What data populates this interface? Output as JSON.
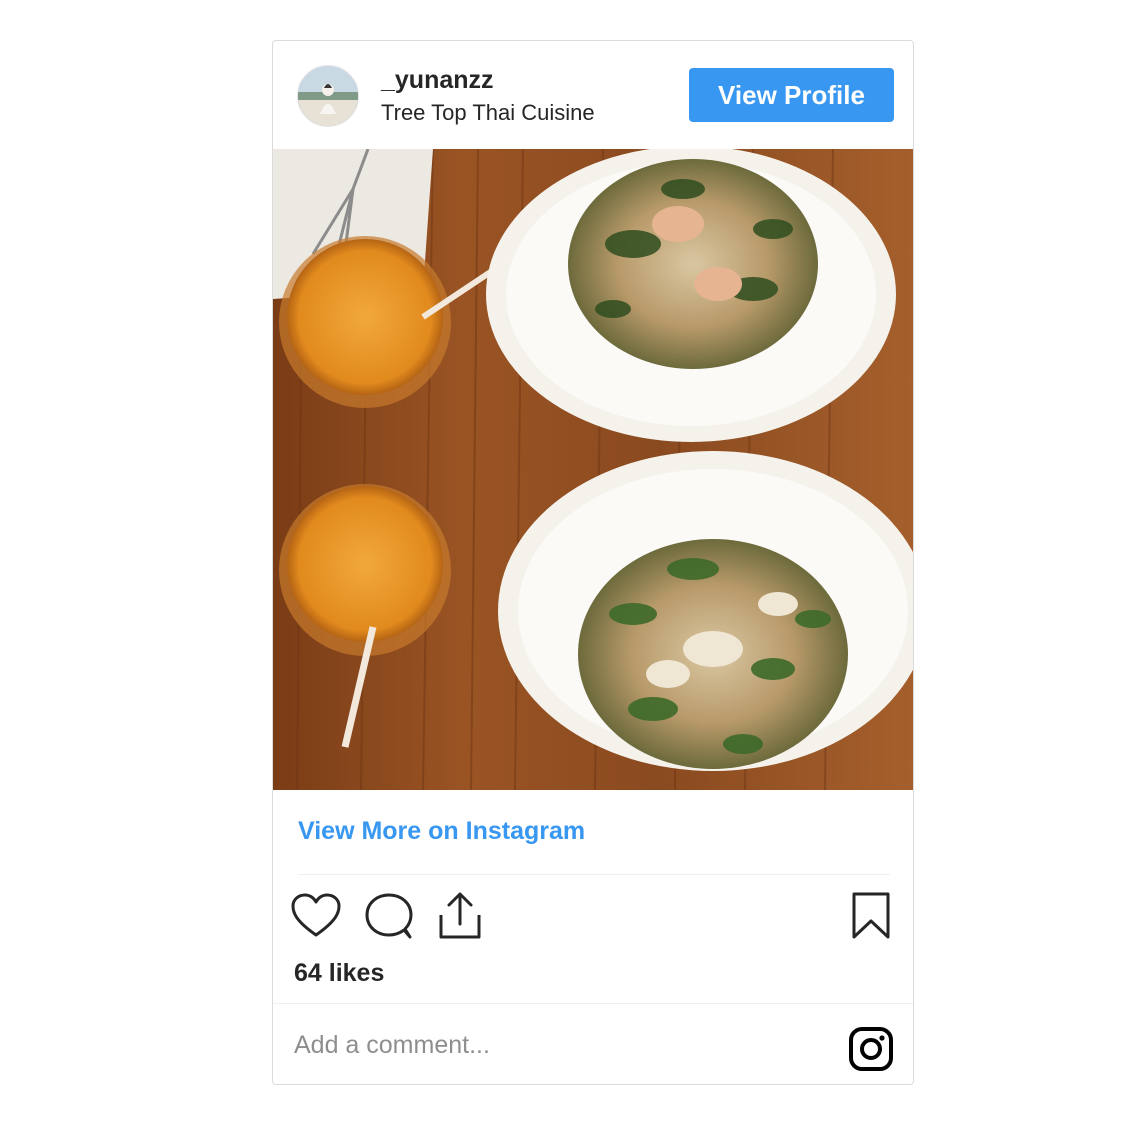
{
  "post": {
    "username": "_yunanzz",
    "location": "Tree Top Thai Cuisine",
    "view_profile_label": "View Profile",
    "view_more_label": "View More on Instagram",
    "likes_text": "64 likes",
    "comment_placeholder": "Add a comment..."
  },
  "icons": {
    "like": "heart-outline-icon",
    "comment": "speech-bubble-icon",
    "share": "share-upload-icon",
    "save": "bookmark-icon",
    "brand": "instagram-logo-icon"
  },
  "colors": {
    "accent": "#3897f0",
    "text": "#262626",
    "muted": "#8e8e8e",
    "border": "#dbdbdb"
  }
}
